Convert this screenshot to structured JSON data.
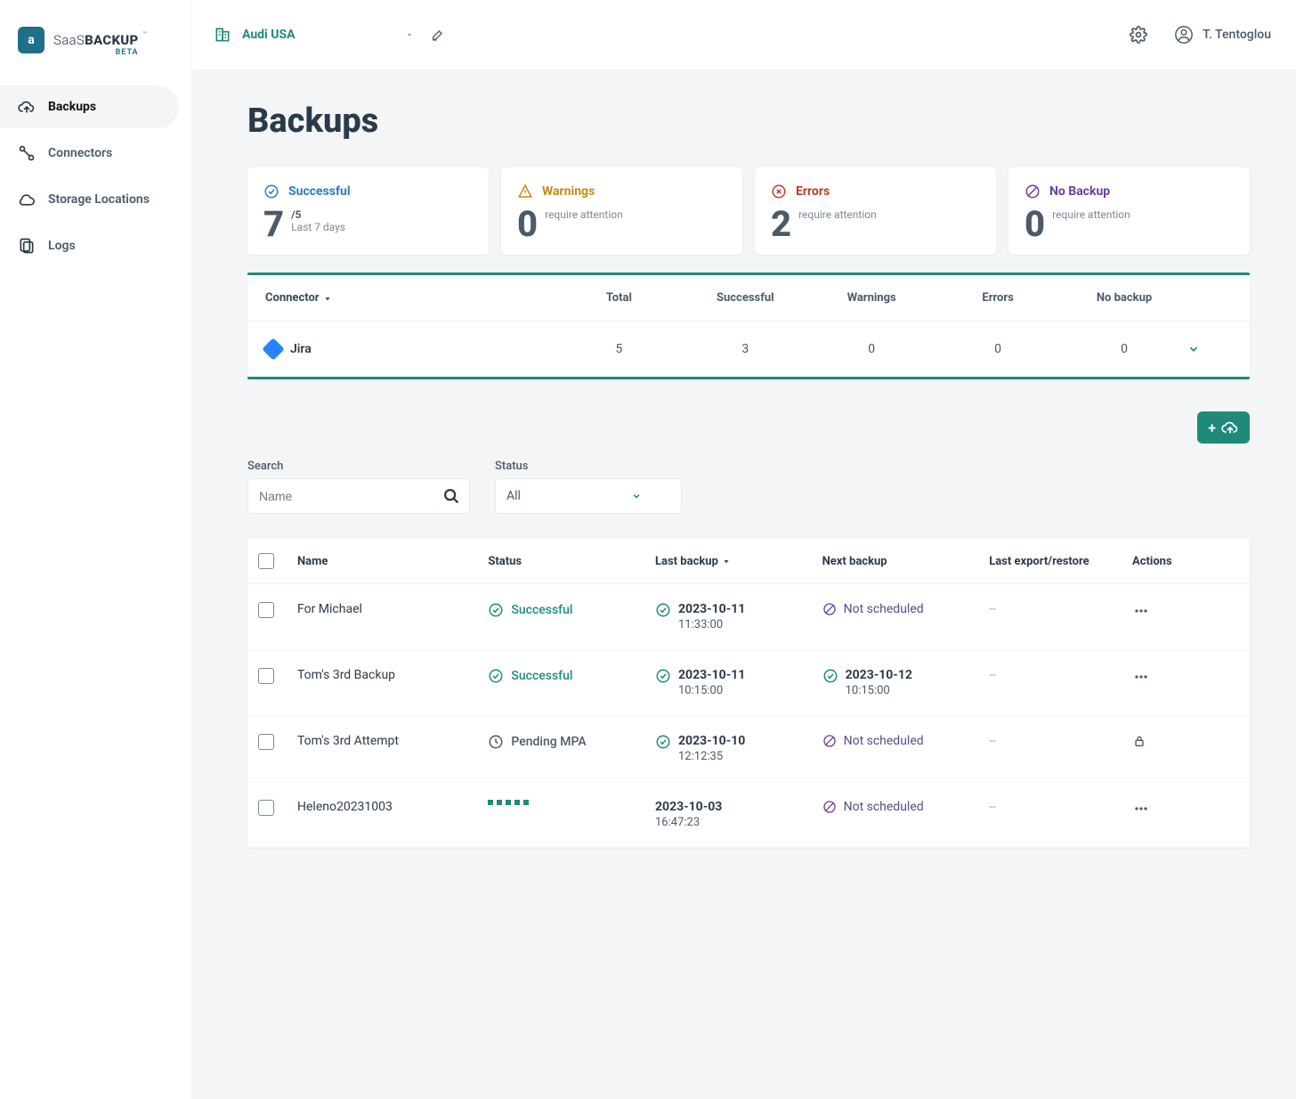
{
  "brand": {
    "prefix": "SaaS",
    "suffix": "BACKUP",
    "tm": "™",
    "beta": "BETA"
  },
  "nav": {
    "items": [
      {
        "label": "Backups"
      },
      {
        "label": "Connectors"
      },
      {
        "label": "Storage Locations"
      },
      {
        "label": "Logs"
      }
    ]
  },
  "topbar": {
    "org_name": "Audi USA",
    "user_name": "T. Tentoglou"
  },
  "page": {
    "title": "Backups"
  },
  "stats": {
    "successful": {
      "title": "Successful",
      "value": "7",
      "sub1": "/5",
      "sub2": "Last 7 days"
    },
    "warnings": {
      "title": "Warnings",
      "value": "0",
      "sub": "require attention"
    },
    "errors": {
      "title": "Errors",
      "value": "2",
      "sub": "require attention"
    },
    "nobackup": {
      "title": "No Backup",
      "value": "0",
      "sub": "require attention"
    }
  },
  "connector_table": {
    "headers": {
      "connector": "Connector",
      "total": "Total",
      "successful": "Successful",
      "warnings": "Warnings",
      "errors": "Errors",
      "nobackup": "No backup"
    },
    "row": {
      "name": "Jira",
      "total": "5",
      "successful": "3",
      "warnings": "0",
      "errors": "0",
      "nobackup": "0"
    }
  },
  "filters": {
    "search_label": "Search",
    "search_placeholder": "Name",
    "status_label": "Status",
    "status_value": "All"
  },
  "btable": {
    "headers": {
      "name": "Name",
      "status": "Status",
      "last": "Last backup",
      "next": "Next backup",
      "export": "Last export/restore",
      "actions": "Actions"
    },
    "not_scheduled": "Not scheduled",
    "dash": "--",
    "rows": [
      {
        "name": "For Michael",
        "status_kind": "success",
        "status": "Successful",
        "last_date": "2023-10-11",
        "last_time": "11:33:00",
        "next_kind": "ns"
      },
      {
        "name": "Tom's 3rd Backup",
        "status_kind": "success",
        "status": "Successful",
        "last_date": "2023-10-11",
        "last_time": "10:15:00",
        "next_kind": "date",
        "next_date": "2023-10-12",
        "next_time": "10:15:00"
      },
      {
        "name": "Tom's 3rd Attempt",
        "status_kind": "pending",
        "status": "Pending MPA",
        "last_date": "2023-10-10",
        "last_time": "12:12:35",
        "next_kind": "ns",
        "action_kind": "lock"
      },
      {
        "name": "Heleno20231003",
        "status_kind": "loading",
        "last_date": "2023-10-03",
        "last_time": "16:47:23",
        "next_kind": "ns",
        "last_icon": "none"
      }
    ]
  }
}
